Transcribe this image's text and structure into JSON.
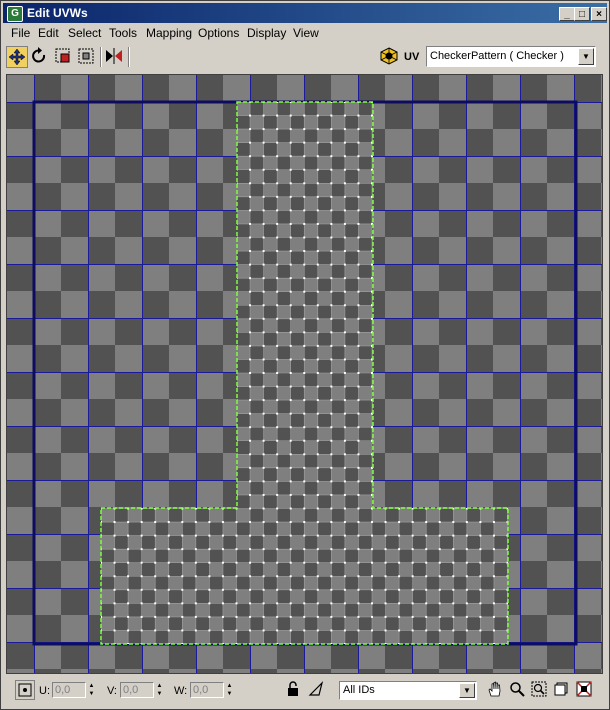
{
  "window": {
    "title": "Edit UVWs",
    "app_icon_glyph": "G"
  },
  "window_buttons": {
    "minimize": "_",
    "maximize": "□",
    "close": "×"
  },
  "menu": [
    "File",
    "Edit",
    "Select",
    "Tools",
    "Mapping",
    "Options",
    "Display",
    "View"
  ],
  "toolbar": {
    "tools": [
      "move-icon",
      "rotate-icon",
      "scale-icon",
      "freeform-icon",
      "mirror-icon"
    ],
    "texture_label": "UV",
    "texture_value": "CheckerPattern  ( Checker )"
  },
  "status": {
    "u_label": "U:",
    "u_value": "0,0",
    "v_label": "V:",
    "v_value": "0,0",
    "w_label": "W:",
    "w_value": "0,0",
    "ids_value": "All IDs"
  },
  "colors": {
    "checker_light": "#7f7f7f",
    "checker_dark": "#525252",
    "grid_line": "#1a1a9a",
    "uv_bound": "#0c0c60",
    "selection": "#7cff3c",
    "vertex": "#ffffff"
  }
}
